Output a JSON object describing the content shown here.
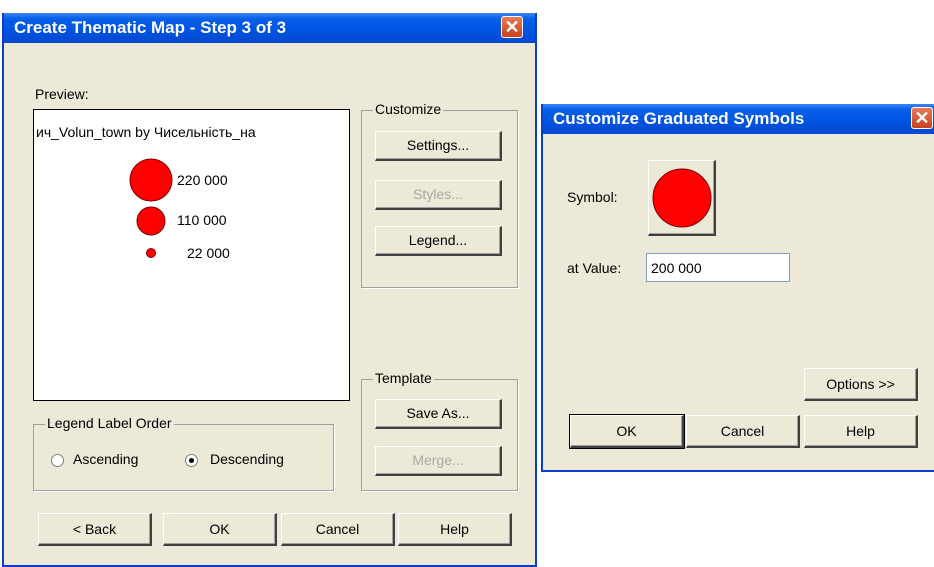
{
  "main_dialog": {
    "title": "Create Thematic Map - Step 3 of 3",
    "close_glyph": "✕",
    "preview_label": "Preview:",
    "preview_title": "ич_Volun_town by Чисельність_на",
    "legend_entries": [
      {
        "label": "220 000"
      },
      {
        "label": "110 000"
      },
      {
        "label": "22 000"
      }
    ],
    "customize": {
      "label": "Customize",
      "settings": "Settings...",
      "styles": "Styles...",
      "legend": "Legend..."
    },
    "template": {
      "label": "Template",
      "save_as": "Save As...",
      "merge": "Merge..."
    },
    "legend_order": {
      "label": "Legend Label Order",
      "ascending": "Ascending",
      "descending": "Descending",
      "selected": "Descending"
    },
    "buttons": {
      "back": "< Back",
      "ok": "OK",
      "cancel": "Cancel",
      "help": "Help"
    }
  },
  "symbols_dialog": {
    "title": "Customize Graduated Symbols",
    "close_glyph": "✕",
    "symbol_label": "Symbol:",
    "value_label": "at Value:",
    "value": "200 000",
    "symbol_color": "#ff0000",
    "buttons": {
      "options": "Options >>",
      "ok": "OK",
      "cancel": "Cancel",
      "help": "Help"
    }
  },
  "colors": {
    "title_bar": "#0054e3",
    "dialog_bg": "#ece9d8",
    "symbol_red": "#ff0000"
  }
}
